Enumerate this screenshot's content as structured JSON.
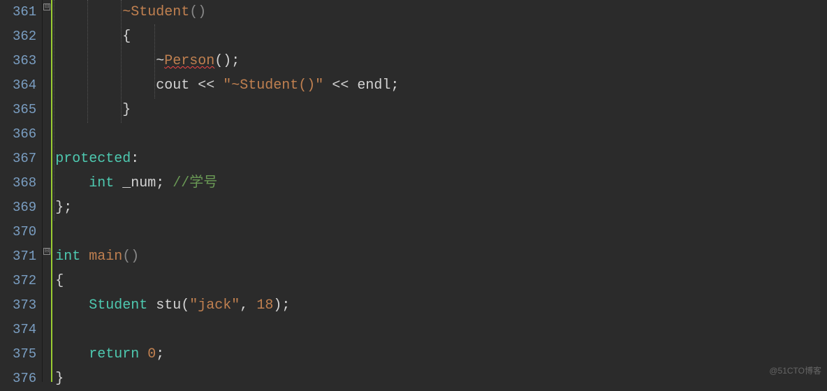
{
  "lineNumbers": [
    "361",
    "362",
    "363",
    "364",
    "365",
    "366",
    "367",
    "368",
    "369",
    "370",
    "371",
    "372",
    "373",
    "374",
    "375",
    "376"
  ],
  "foldMarkers": [
    {
      "line": 0,
      "symbol": "⊟"
    },
    {
      "line": 10,
      "symbol": "⊟"
    }
  ],
  "code": {
    "l361": {
      "indent": "        ",
      "t1": "~",
      "t2": "Student",
      "t3": "()"
    },
    "l362": {
      "indent": "        ",
      "t1": "{"
    },
    "l363": {
      "indent": "            ",
      "t1": "~",
      "t2": "Person",
      "t3": "();"
    },
    "l364": {
      "indent": "            ",
      "t1": "cout",
      "t2": " << ",
      "t3": "\"~Student()\"",
      "t4": " << ",
      "t5": "endl",
      "t6": ";"
    },
    "l365": {
      "indent": "        ",
      "t1": "}"
    },
    "l366": {
      "t1": ""
    },
    "l367": {
      "t1": "protected",
      "t2": ":"
    },
    "l368": {
      "indent": "    ",
      "t1": "int",
      "t2": " ",
      "t3": "_num",
      "t4": "; ",
      "t5": "//学号"
    },
    "l369": {
      "t1": "};"
    },
    "l370": {
      "t1": ""
    },
    "l371": {
      "t1": "int",
      "t2": " ",
      "t3": "main",
      "t4": "()"
    },
    "l372": {
      "t1": "{"
    },
    "l373": {
      "indent": "    ",
      "t1": "Student",
      "t2": " ",
      "t3": "stu",
      "t4": "(",
      "t5": "\"jack\"",
      "t6": ", ",
      "t7": "18",
      "t8": ");"
    },
    "l374": {
      "t1": ""
    },
    "l375": {
      "indent": "    ",
      "t1": "return",
      "t2": " ",
      "t3": "0",
      "t4": ";"
    },
    "l376": {
      "t1": "}"
    }
  },
  "watermark": "@51CTO博客"
}
